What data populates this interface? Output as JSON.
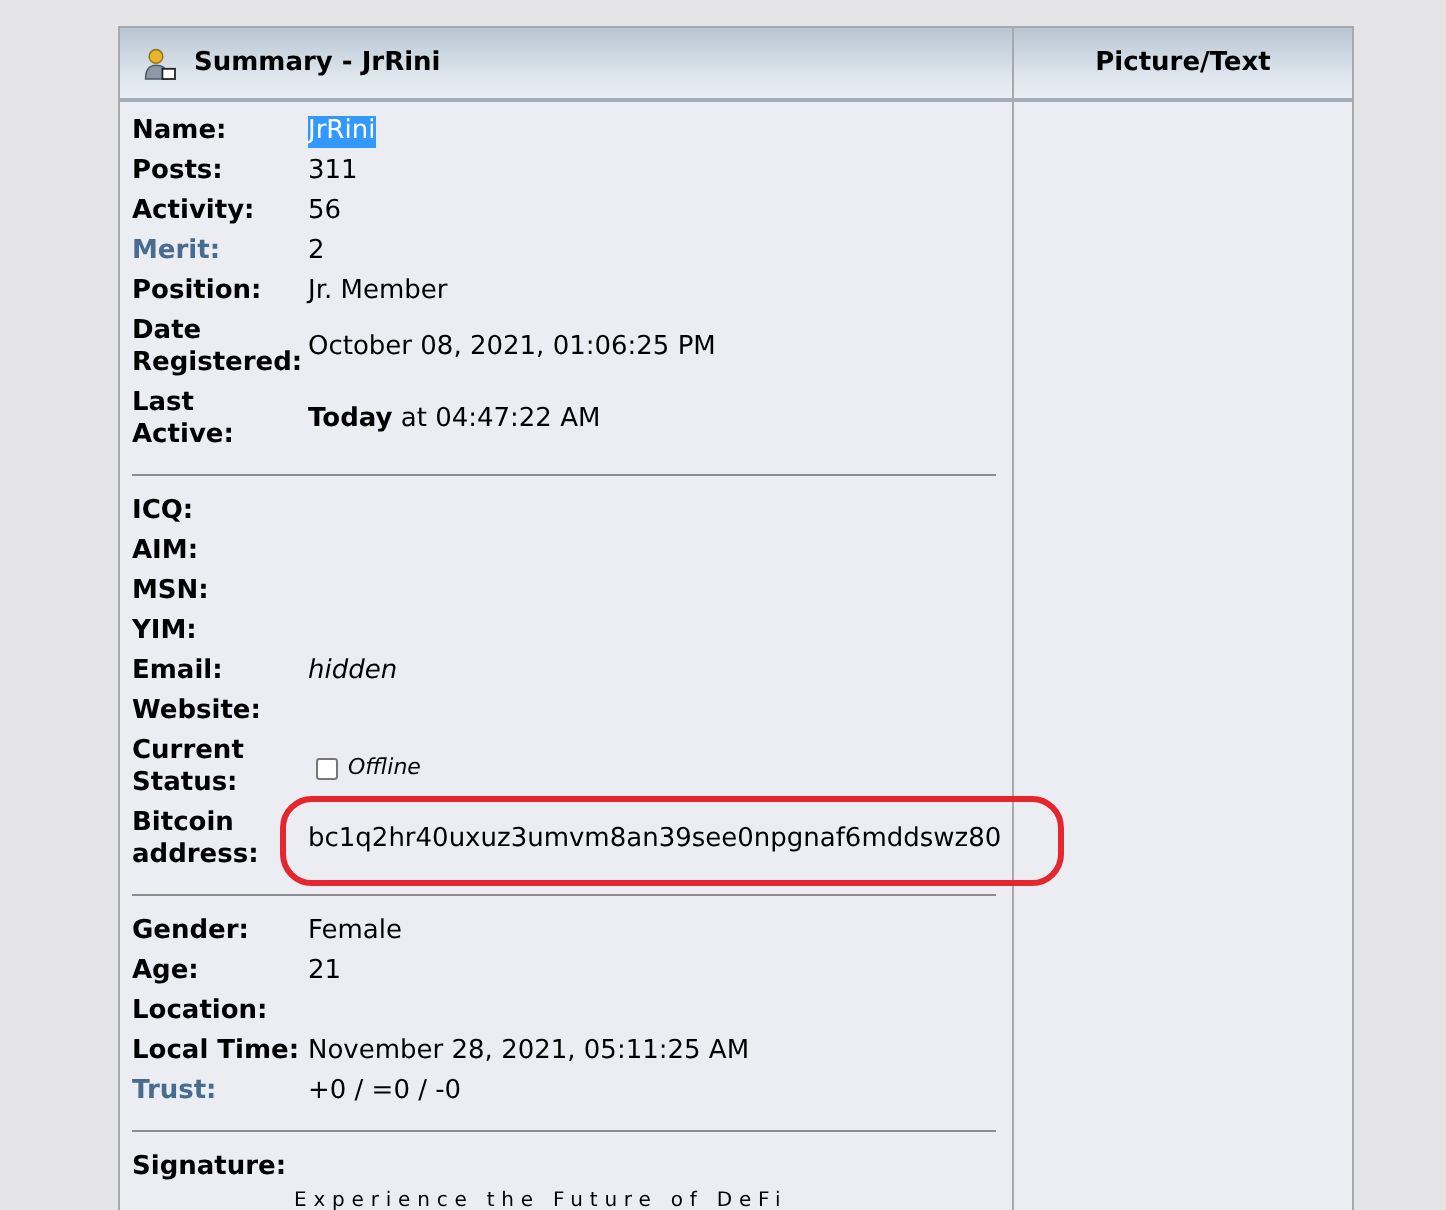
{
  "profile": {
    "header": {
      "title": "Summary - JrRini",
      "side_title": "Picture/Text"
    },
    "sections": [
      {
        "rows": [
          {
            "label": "Name:",
            "link": false,
            "kind": "text",
            "value": "JrRini",
            "highlighted": true,
            "circled": false
          },
          {
            "label": "Posts:",
            "link": false,
            "kind": "text",
            "value": "311",
            "highlighted": false,
            "circled": false
          },
          {
            "label": "Activity:",
            "link": false,
            "kind": "text",
            "value": "56",
            "highlighted": false,
            "circled": false
          },
          {
            "label": "Merit:",
            "link": true,
            "kind": "text",
            "value": "2",
            "highlighted": false,
            "circled": false
          },
          {
            "label": "Position:",
            "link": false,
            "kind": "text",
            "value": "Jr. Member",
            "highlighted": false,
            "circled": false
          },
          {
            "label": "Date Registered:",
            "link": false,
            "kind": "text",
            "value": "October 08, 2021, 01:06:25 PM",
            "highlighted": false,
            "circled": false
          },
          {
            "label": "Last Active:",
            "link": false,
            "kind": "text",
            "value": "**Today** at 04:47:22 AM",
            "highlighted": false,
            "circled": false
          }
        ]
      },
      {
        "rows": [
          {
            "label": "ICQ:",
            "link": false,
            "kind": "blank"
          },
          {
            "label": "AIM:",
            "link": false,
            "kind": "blank"
          },
          {
            "label": "MSN:",
            "link": false,
            "kind": "blank"
          },
          {
            "label": "YIM:",
            "link": false,
            "kind": "blank"
          },
          {
            "label": "Email:",
            "link": false,
            "kind": "italic",
            "value": "hidden",
            "highlighted": false,
            "circled": false
          },
          {
            "label": "Website:",
            "link": false,
            "kind": "blank"
          },
          {
            "label": "Current Status:",
            "link": false,
            "kind": "status",
            "value": "Offline",
            "online": false,
            "highlighted": false,
            "circled": false
          },
          {
            "label": "Bitcoin address:",
            "link": false,
            "kind": "text",
            "value": "bc1q2hr40uxuz3umvm8an39see0npgnaf6mddswz80",
            "highlighted": false,
            "circled": true
          }
        ]
      },
      {
        "rows": [
          {
            "label": "Gender:",
            "link": false,
            "kind": "text",
            "value": "Female",
            "highlighted": false,
            "circled": false
          },
          {
            "label": "Age:",
            "link": false,
            "kind": "text",
            "value": "21",
            "highlighted": false,
            "circled": false
          },
          {
            "label": "Location:",
            "link": false,
            "kind": "blank"
          },
          {
            "label": "Local Time:",
            "link": false,
            "kind": "text",
            "value": "November 28, 2021, 05:11:25 AM",
            "highlighted": false,
            "circled": false
          },
          {
            "label": "Trust:",
            "link": true,
            "kind": "text",
            "value": "+0 / =0 / -0",
            "highlighted": false,
            "circled": false
          }
        ]
      }
    ],
    "signature": {
      "label": "Signature:",
      "text": "Experience the Future of DeFi"
    }
  }
}
